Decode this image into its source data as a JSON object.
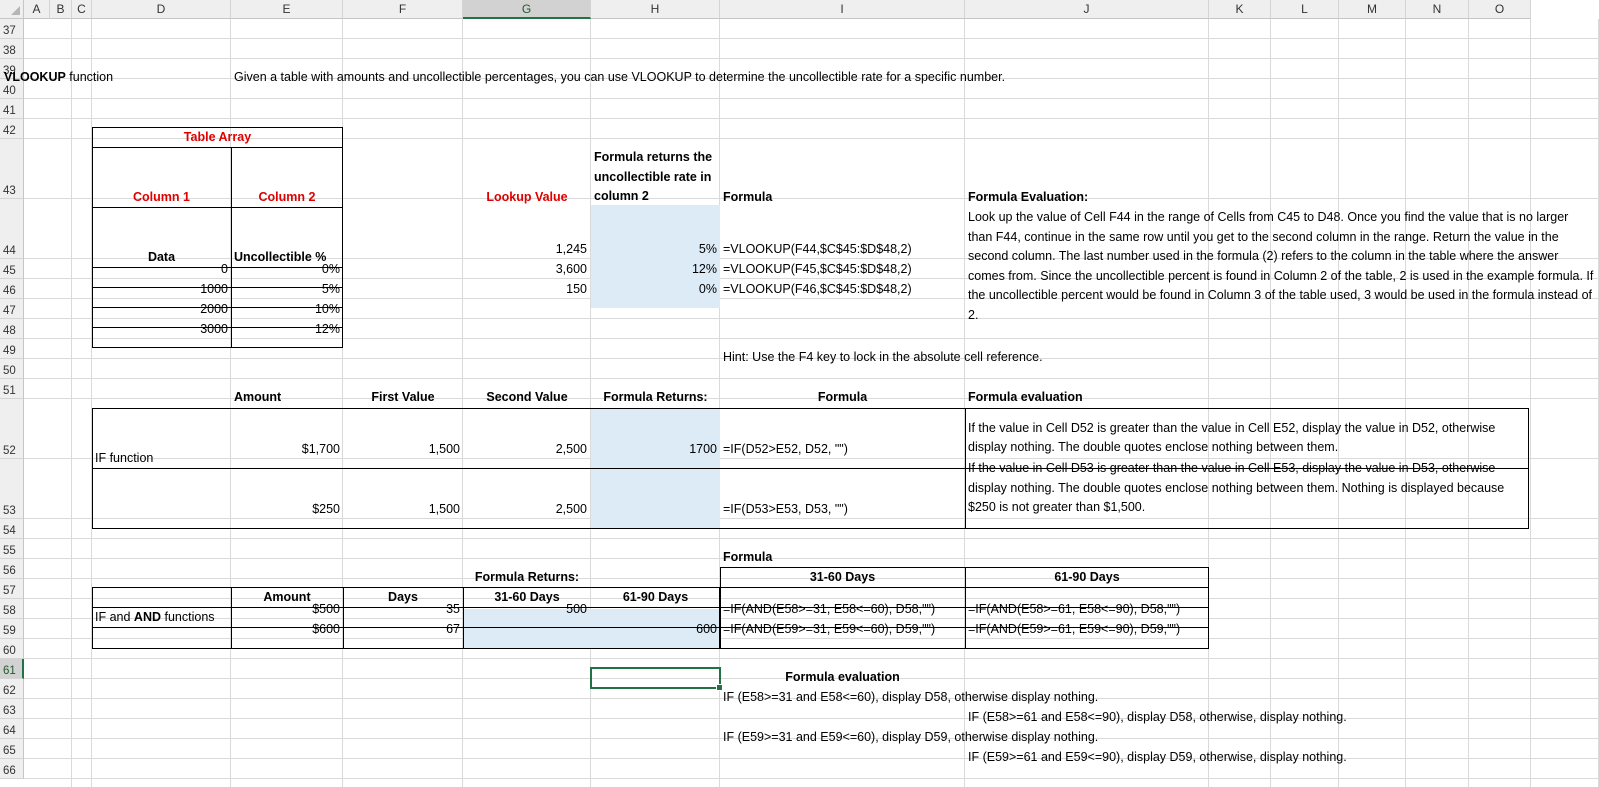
{
  "columns": [
    "A",
    "B",
    "C",
    "D",
    "E",
    "F",
    "G",
    "H",
    "I",
    "J",
    "K",
    "L",
    "M",
    "N",
    "O"
  ],
  "selected_column": "G",
  "selected_row": "61",
  "rows": [
    "37",
    "38",
    "39",
    "40",
    "41",
    "42",
    "43",
    "44",
    "45",
    "46",
    "47",
    "48",
    "49",
    "50",
    "51",
    "52",
    "53",
    "54",
    "55",
    "56",
    "57",
    "58",
    "59",
    "60",
    "61",
    "62",
    "63",
    "64",
    "65",
    "66"
  ],
  "vlookup": {
    "title_bold": "VLOOKUP",
    "title_rest": " function",
    "description": "Given a table with amounts and uncollectible percentages, you can use VLOOKUP to determine the uncollectible rate for a specific number.",
    "table_array_label": "Table Array",
    "col1_label": "Column 1",
    "col2_label": "Column 2",
    "data_header": "Data",
    "uncoll_header": "Uncollectible %",
    "table_rows": [
      {
        "data": "0",
        "pct": "0%"
      },
      {
        "data": "1000",
        "pct": "5%"
      },
      {
        "data": "2000",
        "pct": "10%"
      },
      {
        "data": "3000",
        "pct": "12%"
      }
    ],
    "lookup_value_label": "Lookup Value",
    "returns_label": "Formula returns the uncollectible rate in column 2",
    "formula_label": "Formula",
    "evaluation_label": "Formula Evaluation:",
    "lookups": [
      {
        "value": "1,245",
        "result": "5%",
        "formula": "=VLOOKUP(F44,$C$45:$D$48,2)"
      },
      {
        "value": "3,600",
        "result": "12%",
        "formula": "=VLOOKUP(F45,$C$45:$D$48,2)"
      },
      {
        "value": "150",
        "result": "0%",
        "formula": "=VLOOKUP(F46,$C$45:$D$48,2)"
      }
    ],
    "evaluation_text": "Look up the value of Cell F44 in the range of Cells from C45 to D48. Once you find the value that is no larger than F44, continue in the same row until you get to the second column in the range. Return the value in the second column.  The last number used in the formula (2) refers to the column in the table where the answer comes from.  Since the uncollectible percent is found in Column 2 of the table, 2 is used in the example formula.  If the uncollectible percent would be found in Column 3 of the table used, 3 would be used in the formula instead of 2.",
    "hint": "Hint: Use the F4 key to lock in the absolute cell reference."
  },
  "if_section": {
    "header_amount": "Amount",
    "header_first": "First Value",
    "header_second": "Second Value",
    "header_returns": "Formula Returns:",
    "header_formula": "Formula",
    "header_evaluation": "Formula evaluation",
    "label": "IF function",
    "rows": [
      {
        "amount": "$1,700",
        "first": "1,500",
        "second": "2,500",
        "returns": "1700",
        "formula": "=IF(D52>E52, D52, \"\")",
        "evaluation": "If the value in Cell D52 is greater than the value in Cell E52, display the value in D52, otherwise display nothing. The double quotes enclose nothing between them."
      },
      {
        "amount": "$250",
        "first": "1,500",
        "second": "2,500",
        "returns": "",
        "formula": "=IF(D53>E53, D53, \"\")",
        "evaluation": "If the value in Cell D53 is greater than the value in Cell E53, display the value in D53, otherwise display nothing. The double quotes enclose nothing between them. Nothing is displayed because $250 is not greater than $1,500."
      }
    ]
  },
  "ifand_section": {
    "formula_label": "Formula",
    "returns_label": "Formula Returns:",
    "days_31_60": "31-60 Days",
    "days_61_90": "61-90 Days",
    "amount_header": "Amount",
    "days_header": "Days",
    "label_bold_and": "AND",
    "label_pre": "IF and ",
    "label_post": " functions",
    "rows": [
      {
        "amount": "$500",
        "days": "35",
        "r1": "500",
        "r2": "",
        "f1": "=IF(AND(E58>=31, E58<=60), D58,\"\")",
        "f2": "=IF(AND(E58>=61, E58<=90), D58,\"\")"
      },
      {
        "amount": "$600",
        "days": "67",
        "r1": "",
        "r2": "600",
        "f1": "=IF(AND(E59>=31, E59<=60), D59,\"\")",
        "f2": "=IF(AND(E59>=61, E59<=90), D59,\"\")"
      }
    ],
    "evaluation_label": "Formula evaluation",
    "evaluations": [
      "IF (E58>=31 and E58<=60), display D58, otherwise display nothing.",
      "IF (E58>=61 and E58<=90), display D58, otherwise, display nothing.",
      "IF (E59>=31 and E59<=60), display D59, otherwise display nothing.",
      "IF (E59>=61 and E59<=90), display D59, otherwise, display nothing."
    ]
  }
}
